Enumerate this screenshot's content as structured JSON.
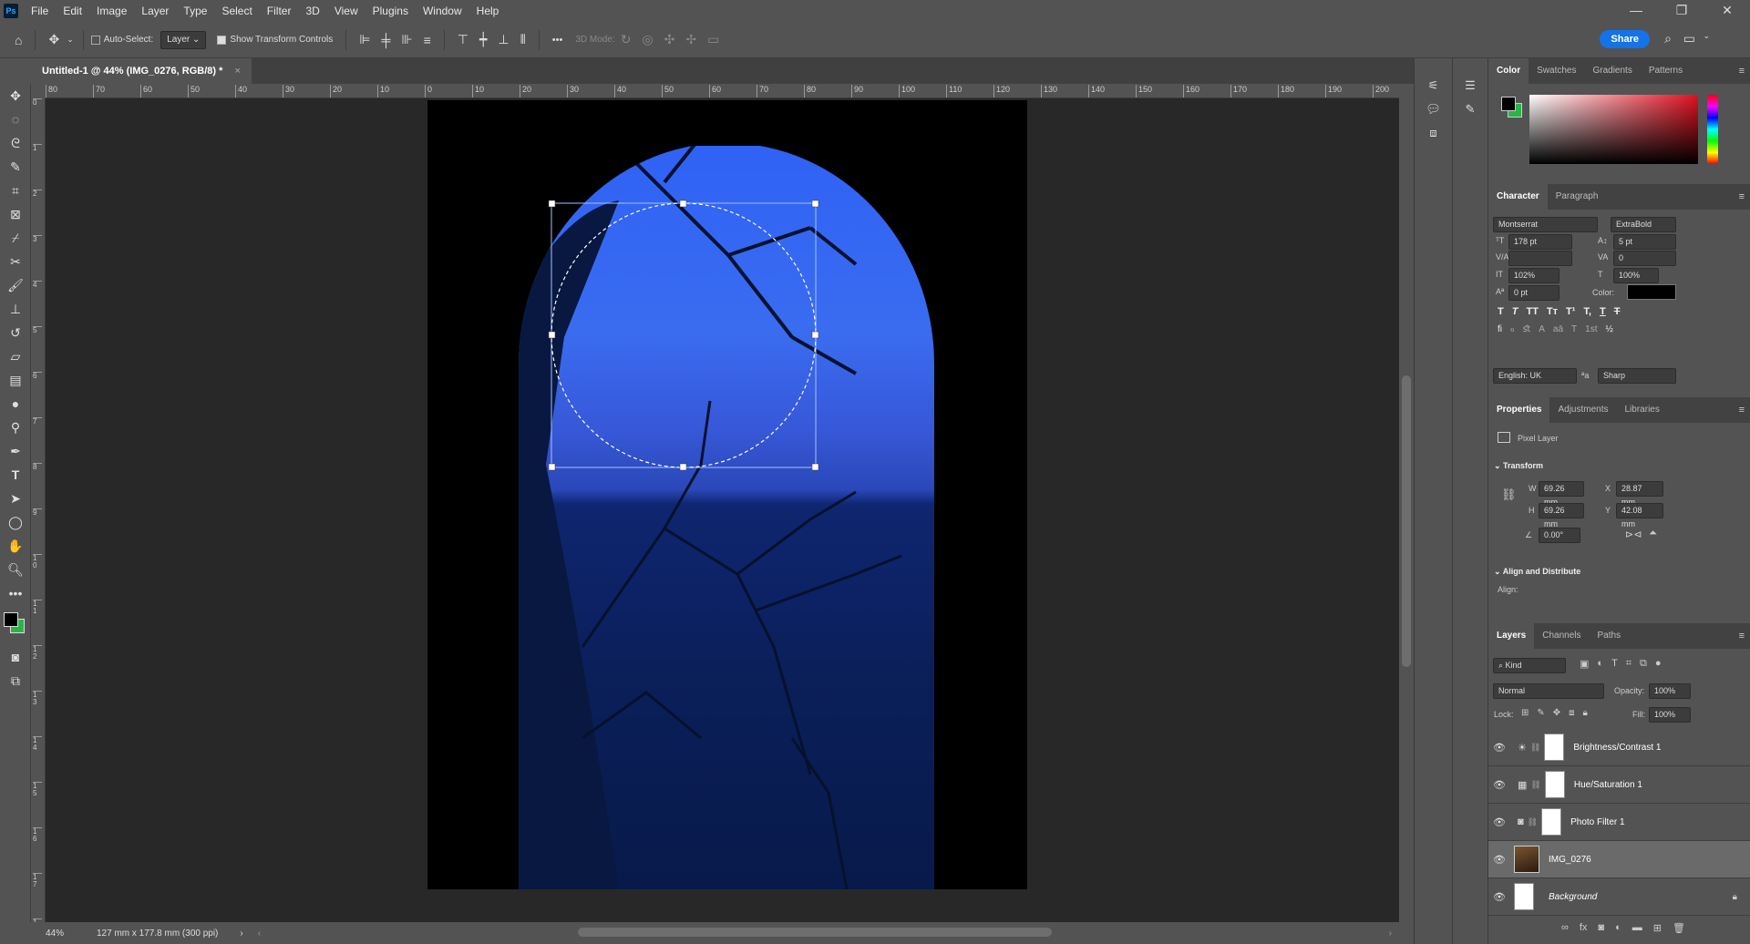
{
  "app": {
    "logo": "Ps"
  },
  "menu": [
    "File",
    "Edit",
    "Image",
    "Layer",
    "Type",
    "Select",
    "Filter",
    "3D",
    "View",
    "Plugins",
    "Window",
    "Help"
  ],
  "options_bar": {
    "auto_select_label": "Auto-Select:",
    "auto_select_target": "Layer",
    "show_transform_label": "Show Transform Controls",
    "mode_3d_label": "3D Mode:",
    "more": "•••",
    "share_label": "Share"
  },
  "document": {
    "tab_title": "Untitled-1 @ 44% (IMG_0276, RGB/8) *",
    "close_glyph": "×"
  },
  "rulers": {
    "h_ticks": [
      "80",
      "70",
      "60",
      "50",
      "40",
      "30",
      "20",
      "10",
      "0",
      "10",
      "20",
      "30",
      "40",
      "50",
      "60",
      "70",
      "80",
      "90",
      "100",
      "110",
      "120",
      "130",
      "140",
      "150",
      "160",
      "170",
      "180",
      "190",
      "200"
    ],
    "v_ticks": [
      "0",
      "1",
      "2",
      "3",
      "4",
      "5",
      "6",
      "7",
      "8",
      "9",
      "1 0",
      "1 1",
      "1 2",
      "1 3",
      "1 4",
      "1 5",
      "1 6",
      "1 7",
      "1 8"
    ]
  },
  "status": {
    "zoom": "44%",
    "doc_info": "127 mm x 177.8 mm (300 ppi)"
  },
  "color_panel": {
    "tabs": [
      "Color",
      "Swatches",
      "Gradients",
      "Patterns"
    ],
    "foreground": "#000000",
    "background": "#2bb34a"
  },
  "character_panel": {
    "tabs": [
      "Character",
      "Paragraph"
    ],
    "font_family": "Montserrat",
    "font_style": "ExtraBold",
    "font_size": "178 pt",
    "leading": "5 pt",
    "kerning": "",
    "tracking": "0",
    "vertical_scale": "102%",
    "horizontal_scale": "100%",
    "baseline_shift": "0 pt",
    "color_label": "Color:",
    "language": "English: UK",
    "antialias": "Sharp",
    "style_glyphs": [
      "T",
      "T",
      "TT",
      "Tт",
      "T¹",
      "T,",
      "T",
      "T"
    ],
    "opentype_glyphs": [
      "fi",
      "ℴ",
      "ﬆ",
      "A",
      "aā",
      "T",
      "1st",
      "½"
    ]
  },
  "properties_panel": {
    "tabs": [
      "Properties",
      "Adjustments",
      "Libraries"
    ],
    "layer_type": "Pixel Layer",
    "transform_heading": "Transform",
    "w_label": "W",
    "w": "69.26 mm",
    "h_label": "H",
    "h": "69.26 mm",
    "x_label": "X",
    "x": "28.87 mm",
    "y_label": "Y",
    "y": "42.08 mm",
    "angle": "0.00°",
    "align_heading": "Align and Distribute",
    "align_label": "Align:"
  },
  "layers_panel": {
    "tabs": [
      "Layers",
      "Channels",
      "Paths"
    ],
    "filter": "Kind",
    "blend_mode": "Normal",
    "opacity_label": "Opacity:",
    "opacity": "100%",
    "lock_label": "Lock:",
    "fill_label": "Fill:",
    "fill": "100%",
    "layers": [
      {
        "name": "Brightness/Contrast 1",
        "icon": "brightness-icon"
      },
      {
        "name": "Hue/Saturation 1",
        "icon": "hue-saturation-icon"
      },
      {
        "name": "Photo Filter 1",
        "icon": "photo-filter-icon"
      },
      {
        "name": "IMG_0276",
        "icon": "image-thumbnail"
      },
      {
        "name": "Background",
        "icon": "background-thumbnail"
      }
    ]
  }
}
